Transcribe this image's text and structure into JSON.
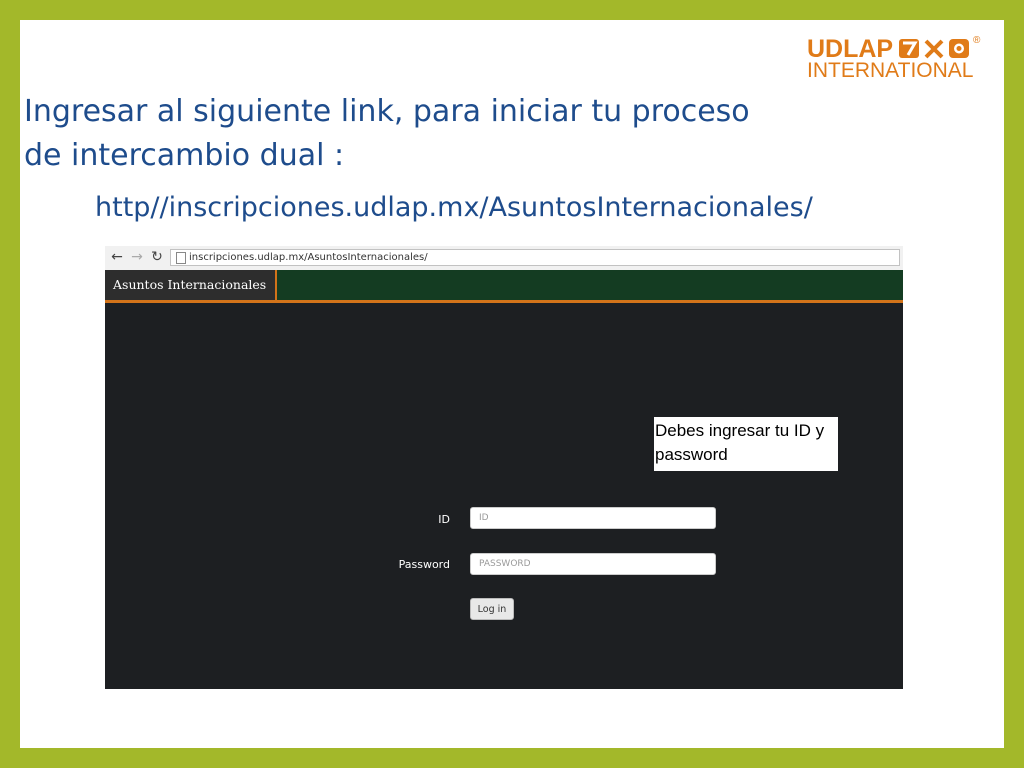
{
  "slide": {
    "heading_line1": "Ingresar al siguiente link, para iniciar tu proceso",
    "heading_line2": "de intercambio dual :",
    "url": "http//inscripciones.udlap.mx/AsuntosInternacionales/"
  },
  "logo": {
    "top": "UDLAP",
    "bottom": "INTERNATIONAL",
    "registered": "®",
    "color": "#e07b18"
  },
  "browser": {
    "address": "inscripciones.udlap.mx/AsuntosInternacionales/",
    "icons": {
      "back": "back-arrow-icon",
      "forward": "forward-arrow-icon",
      "reload": "reload-icon"
    }
  },
  "site": {
    "brand": "Asuntos Internacionales",
    "nav_color": "#143c22",
    "accent_color": "#d2731a"
  },
  "note": {
    "line1": "Debes ingresar tu ID y",
    "line2": "password"
  },
  "login": {
    "id_label": "ID",
    "id_placeholder": "ID",
    "password_label": "Password",
    "password_placeholder": "PASSWORD",
    "button": "Log in"
  }
}
